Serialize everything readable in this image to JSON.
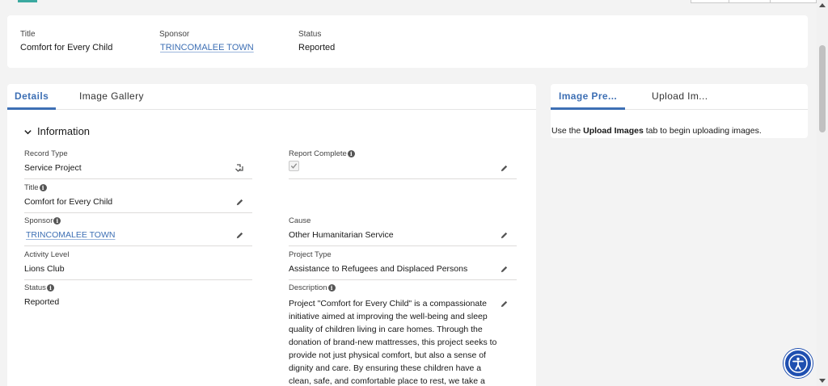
{
  "highlights": {
    "title_label": "Title",
    "title_value": "Comfort for Every Child",
    "sponsor_label": "Sponsor",
    "sponsor_value": "TRINCOMALEE TOWN",
    "status_label": "Status",
    "status_value": "Reported"
  },
  "main_tabs": {
    "details": "Details",
    "gallery": "Image Gallery"
  },
  "section": {
    "title": "Information"
  },
  "fields": {
    "record_type": {
      "label": "Record Type",
      "value": "Service Project"
    },
    "report_complete": {
      "label": "Report Complete",
      "checked": true
    },
    "title": {
      "label": "Title",
      "value": "Comfort for Every Child"
    },
    "sponsor": {
      "label": "Sponsor",
      "value": "TRINCOMALEE TOWN"
    },
    "cause": {
      "label": "Cause",
      "value": "Other Humanitarian Service"
    },
    "activity_level": {
      "label": "Activity Level",
      "value": "Lions Club"
    },
    "project_type": {
      "label": "Project Type",
      "value": "Assistance to Refugees and Displaced Persons"
    },
    "status": {
      "label": "Status",
      "value": "Reported"
    },
    "description": {
      "label": "Description",
      "value": "Project \"Comfort for Every Child\" is a compassionate initiative aimed at improving the well-being and sleep quality of children living in care homes. Through the donation of brand-new mattresses, this project seeks to provide not just physical comfort, but also a sense of dignity and care. By ensuring these children have a clean, safe, and comfortable place to rest, we take a"
    }
  },
  "side_panel": {
    "tab_preview": "Image Pre...",
    "tab_upload": "Upload Im...",
    "msg_prefix": "Use the ",
    "msg_bold": "Upload Images",
    "msg_suffix": " tab to begin uploading images."
  },
  "colors": {
    "brand": "#3d6fb4",
    "accessibility_button": "#1f4fb0",
    "logo_teal": "#3ba9a0"
  },
  "icons": [
    "pencil-icon",
    "info-icon",
    "chevron-down-icon",
    "change-record-type-icon",
    "check-icon",
    "accessibility-icon"
  ]
}
